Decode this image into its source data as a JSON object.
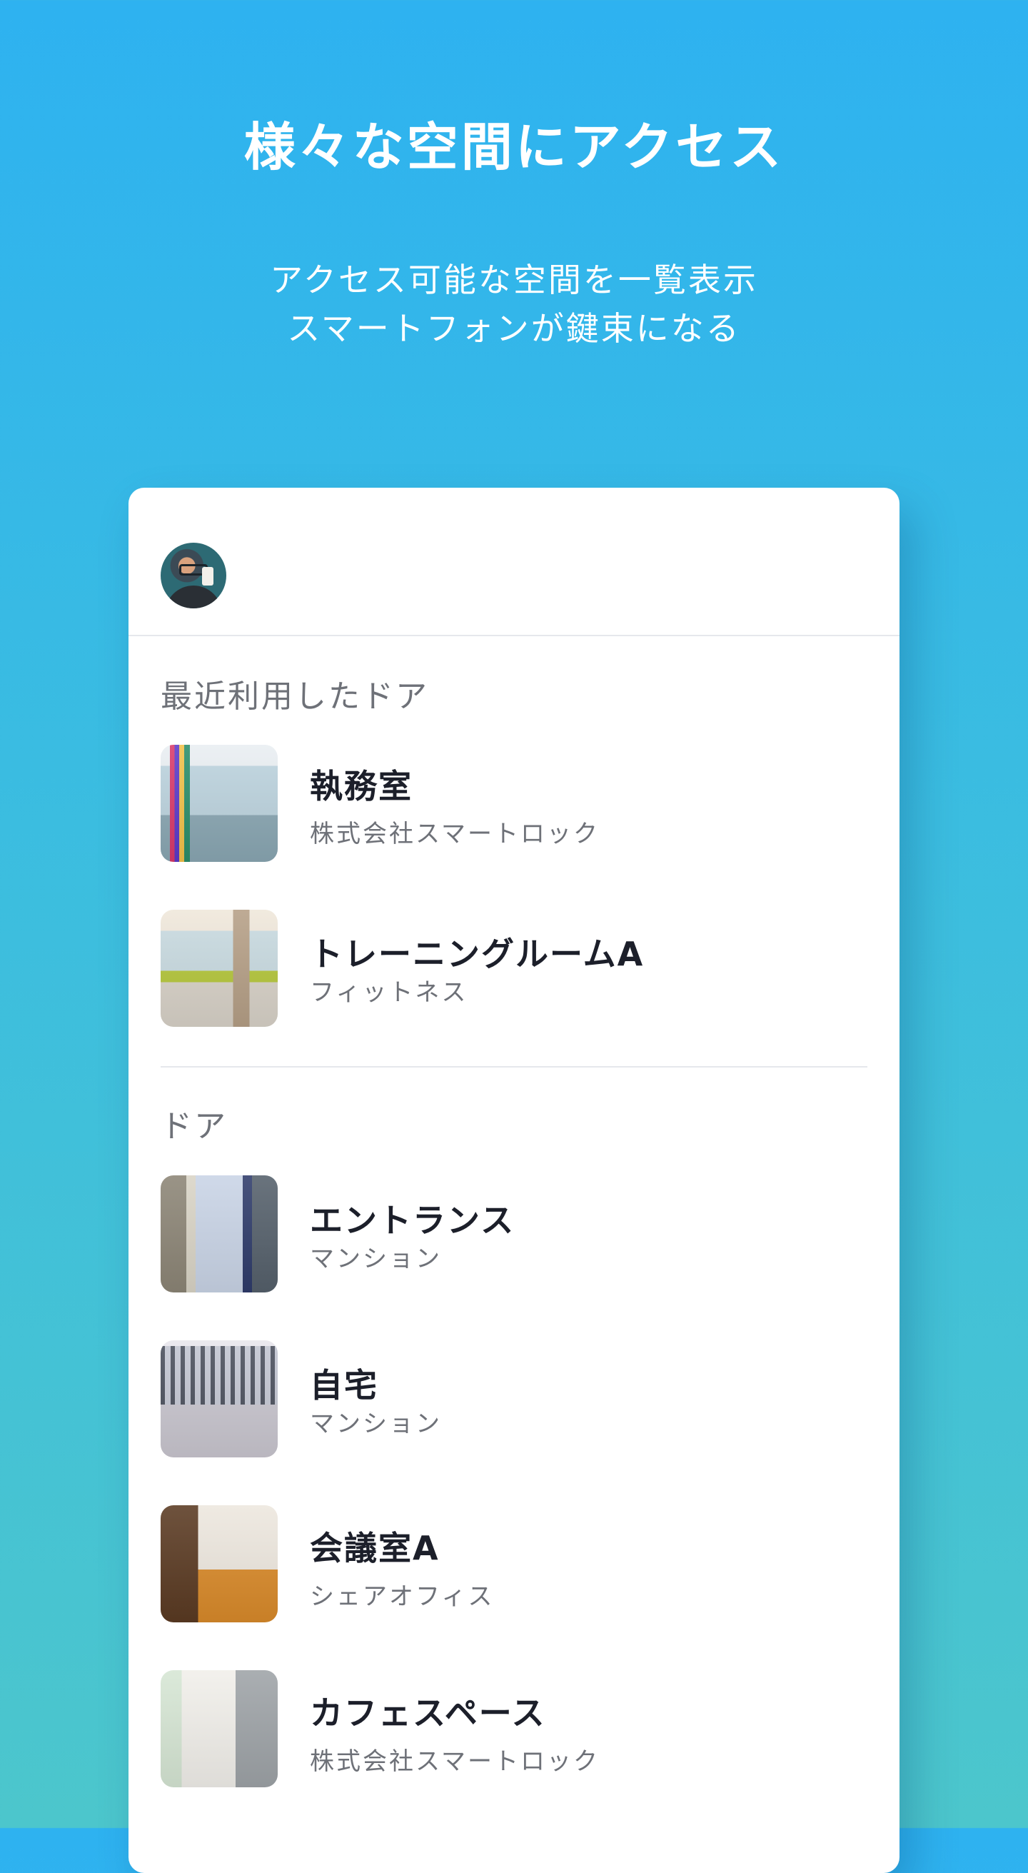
{
  "hero": {
    "title": "様々な空間にアクセス",
    "subtitle_line1": "アクセス可能な空間を一覧表示",
    "subtitle_line2": "スマートフォンが鍵束になる"
  },
  "card": {
    "recent_section_label": "最近利用したドア",
    "doors_section_label": "ドア",
    "recent_items": [
      {
        "title": "執務室",
        "subtitle": "株式会社スマートロック",
        "thumb": "office-photo"
      },
      {
        "title": "トレーニングルームA",
        "subtitle": "フィットネス",
        "thumb": "training-room-photo"
      }
    ],
    "door_items": [
      {
        "title": "エントランス",
        "subtitle": "マンション",
        "thumb": "entrance-photo"
      },
      {
        "title": "自宅",
        "subtitle": "マンション",
        "thumb": "home-photo"
      },
      {
        "title": "会議室A",
        "subtitle": "シェアオフィス",
        "thumb": "meeting-room-photo"
      },
      {
        "title": "カフェスペース",
        "subtitle": "株式会社スマートロック",
        "thumb": "cafe-space-photo"
      }
    ]
  },
  "colors": {
    "background_top": "#2eb2f0",
    "background_bottom": "#4cc6cc",
    "card": "#ffffff",
    "title_text": "#1c1f2a",
    "secondary_text": "#6e7178"
  }
}
